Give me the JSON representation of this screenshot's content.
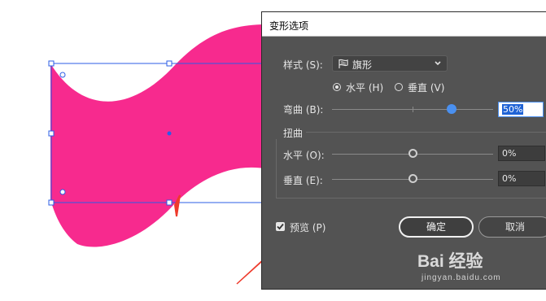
{
  "dialog": {
    "title": "变形选项",
    "style_label": "样式 (S):",
    "style_value": "旗形",
    "orientation": {
      "horizontal_label": "水平 (H)",
      "vertical_label": "垂直 (V)",
      "selected": "horizontal"
    },
    "bend": {
      "label": "弯曲 (B):",
      "value_text": "50%",
      "value": 50
    },
    "distortion": {
      "group_label": "扭曲",
      "horizontal": {
        "label": "水平 (O):",
        "value_text": "0%",
        "value": 0
      },
      "vertical": {
        "label": "垂直 (E):",
        "value_text": "0%",
        "value": 0
      }
    },
    "preview": {
      "label": "预览 (P)",
      "checked": true
    },
    "ok_label": "确定",
    "cancel_label": "取消"
  },
  "artboard": {
    "shape_color": "#f72a8e",
    "selection_color": "#2b5ce6",
    "annotation_arrow_color": "#ee3b2c"
  },
  "watermark": {
    "brand": "Bai 经验",
    "url": "jingyan.baidu.com"
  }
}
